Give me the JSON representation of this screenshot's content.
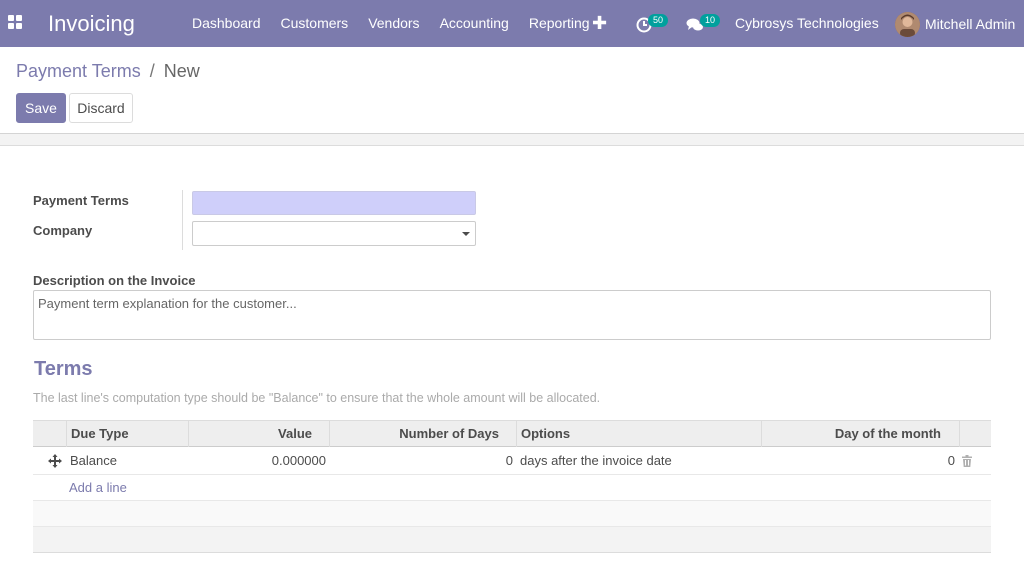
{
  "navbar": {
    "app_name": "Invoicing",
    "menu": [
      "Dashboard",
      "Customers",
      "Vendors",
      "Accounting",
      "Reporting"
    ],
    "activity_count": "50",
    "message_count": "10",
    "company": "Cybrosys Technologies",
    "user": "Mitchell Admin",
    "colors": {
      "navbar_bg": "#7c7bad",
      "badge": "#00a09d"
    }
  },
  "breadcrumb": {
    "parent": "Payment Terms",
    "separator": "/",
    "current": "New"
  },
  "buttons": {
    "save": "Save",
    "discard": "Discard"
  },
  "form": {
    "payment_terms_label": "Payment Terms",
    "payment_terms_value": "",
    "company_label": "Company",
    "company_value": "",
    "description_label": "Description on the Invoice",
    "description_placeholder": "Payment term explanation for the customer..."
  },
  "terms": {
    "title": "Terms",
    "help": "The last line's computation type should be \"Balance\" to ensure that the whole amount will be allocated.",
    "columns": [
      "Due Type",
      "Value",
      "Number of Days",
      "Options",
      "Day of the month"
    ],
    "rows": [
      {
        "due_type": "Balance",
        "value": "0.000000",
        "days": "0",
        "option": "days after the invoice date",
        "day_of_month": "0"
      }
    ],
    "add_line": "Add a line"
  }
}
